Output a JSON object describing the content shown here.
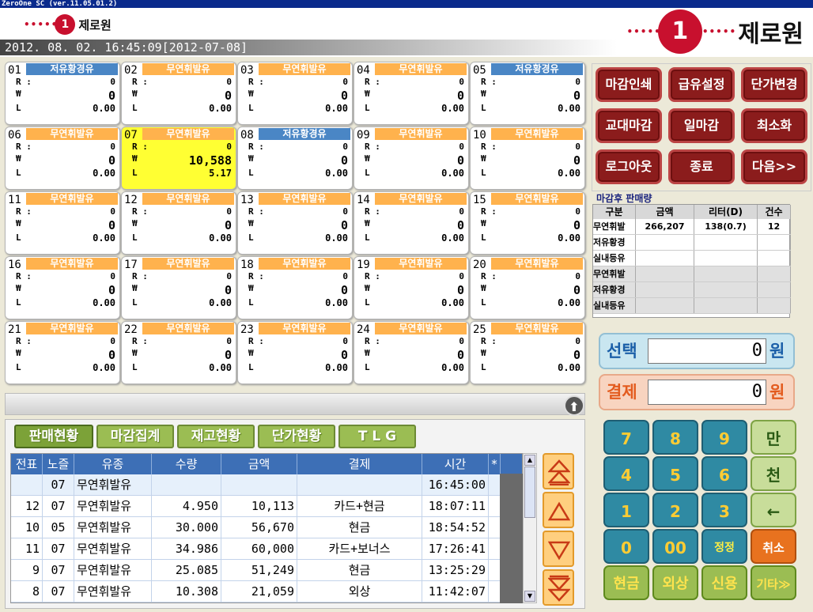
{
  "window": {
    "title": "ZeroOne SC (ver.11.05.01.2)"
  },
  "brand": {
    "small_logo": "제로원",
    "big_logo": "제로원",
    "logo_mark": "1",
    "dots": "•••••"
  },
  "datetime": "2012. 08. 02. 16:45:09[2012-07-08]",
  "field_labels": {
    "r": "R :",
    "won": "₩",
    "l": "L"
  },
  "nozzles": [
    {
      "no": "01",
      "fuel": "저유황경유",
      "color": "b",
      "r": "0",
      "w": "0",
      "l": "0.00"
    },
    {
      "no": "02",
      "fuel": "무연휘발유",
      "color": "o",
      "r": "0",
      "w": "0",
      "l": "0.00"
    },
    {
      "no": "03",
      "fuel": "무연휘발유",
      "color": "o",
      "r": "0",
      "w": "0",
      "l": "0.00"
    },
    {
      "no": "04",
      "fuel": "무연휘발유",
      "color": "o",
      "r": "0",
      "w": "0",
      "l": "0.00"
    },
    {
      "no": "05",
      "fuel": "저유황경유",
      "color": "b",
      "r": "0",
      "w": "0",
      "l": "0.00"
    },
    {
      "no": "06",
      "fuel": "무연휘발유",
      "color": "o",
      "r": "0",
      "w": "0",
      "l": "0.00"
    },
    {
      "no": "07",
      "fuel": "무연휘발유",
      "color": "o",
      "r": "0",
      "w": "10,588",
      "l": "5.17",
      "selected": true
    },
    {
      "no": "08",
      "fuel": "저유황경유",
      "color": "b",
      "r": "0",
      "w": "0",
      "l": "0.00"
    },
    {
      "no": "09",
      "fuel": "무연휘발유",
      "color": "o",
      "r": "0",
      "w": "0",
      "l": "0.00"
    },
    {
      "no": "10",
      "fuel": "무연휘발유",
      "color": "o",
      "r": "0",
      "w": "0",
      "l": "0.00"
    },
    {
      "no": "11",
      "fuel": "무연휘발유",
      "color": "o",
      "r": "0",
      "w": "0",
      "l": "0.00"
    },
    {
      "no": "12",
      "fuel": "무연휘발유",
      "color": "o",
      "r": "0",
      "w": "0",
      "l": "0.00"
    },
    {
      "no": "13",
      "fuel": "무연휘발유",
      "color": "o",
      "r": "0",
      "w": "0",
      "l": "0.00"
    },
    {
      "no": "14",
      "fuel": "무연휘발유",
      "color": "o",
      "r": "0",
      "w": "0",
      "l": "0.00"
    },
    {
      "no": "15",
      "fuel": "무연휘발유",
      "color": "o",
      "r": "0",
      "w": "0",
      "l": "0.00"
    },
    {
      "no": "16",
      "fuel": "무연휘발유",
      "color": "o",
      "r": "0",
      "w": "0",
      "l": "0.00"
    },
    {
      "no": "17",
      "fuel": "무연휘발유",
      "color": "o",
      "r": "0",
      "w": "0",
      "l": "0.00"
    },
    {
      "no": "18",
      "fuel": "무연휘발유",
      "color": "o",
      "r": "0",
      "w": "0",
      "l": "0.00"
    },
    {
      "no": "19",
      "fuel": "무연휘발유",
      "color": "o",
      "r": "0",
      "w": "0",
      "l": "0.00"
    },
    {
      "no": "20",
      "fuel": "무연휘발유",
      "color": "o",
      "r": "0",
      "w": "0",
      "l": "0.00"
    },
    {
      "no": "21",
      "fuel": "무연휘발유",
      "color": "o",
      "r": "0",
      "w": "0",
      "l": "0.00"
    },
    {
      "no": "22",
      "fuel": "무연휘발유",
      "color": "o",
      "r": "0",
      "w": "0",
      "l": "0.00"
    },
    {
      "no": "23",
      "fuel": "무연휘발유",
      "color": "o",
      "r": "0",
      "w": "0",
      "l": "0.00"
    },
    {
      "no": "24",
      "fuel": "무연휘발유",
      "color": "o",
      "r": "0",
      "w": "0",
      "l": "0.00"
    },
    {
      "no": "25",
      "fuel": "무연휘발유",
      "color": "o",
      "r": "0",
      "w": "0",
      "l": "0.00"
    }
  ],
  "tabs": [
    "판매현황",
    "마감집계",
    "재고현황",
    "단가현황",
    "T L G"
  ],
  "table": {
    "headers": [
      "전표",
      "노즐",
      "유종",
      "수량",
      "금액",
      "결제",
      "시간",
      "*"
    ],
    "rows": [
      [
        "",
        "07",
        "무연휘발유",
        "",
        "",
        "",
        "16:45:00"
      ],
      [
        "12",
        "07",
        "무연휘발유",
        "4.950",
        "10,113",
        "카드+현금",
        "18:07:11"
      ],
      [
        "10",
        "05",
        "무연휘발유",
        "30.000",
        "56,670",
        "현금",
        "18:54:52"
      ],
      [
        "11",
        "07",
        "무연휘발유",
        "34.986",
        "60,000",
        "카드+보너스",
        "17:26:41"
      ],
      [
        "9",
        "07",
        "무연휘발유",
        "25.085",
        "51,249",
        "현금",
        "13:25:29"
      ],
      [
        "8",
        "07",
        "무연휘발유",
        "10.308",
        "21,059",
        "외상",
        "11:42:07"
      ]
    ]
  },
  "functions": [
    "마감인쇄",
    "급유설정",
    "단가변경",
    "교대마감",
    "일마감",
    "최소화",
    "로그아웃",
    "종료",
    "다음>>"
  ],
  "summary": {
    "title": "마감후 판매량",
    "headers": [
      "구분",
      "금액",
      "리터(D)",
      "건수"
    ],
    "rows": [
      [
        "무연휘발",
        "266,207",
        "138(0.7)",
        "12"
      ],
      [
        "저유황경",
        "",
        "",
        ""
      ],
      [
        "실내등유",
        "",
        "",
        ""
      ],
      [
        "무연휘발",
        "",
        "",
        ""
      ],
      [
        "저유황경",
        "",
        "",
        ""
      ],
      [
        "실내등유",
        "",
        "",
        ""
      ]
    ]
  },
  "select": {
    "label": "선택",
    "value": "0",
    "unit": "원"
  },
  "payment": {
    "label": "결제",
    "value": "0",
    "unit": "원"
  },
  "keypad": {
    "k7": "7",
    "k8": "8",
    "k9": "9",
    "man": "만",
    "k4": "4",
    "k5": "5",
    "k6": "6",
    "cheon": "천",
    "k1": "1",
    "k2": "2",
    "k3": "3",
    "back": "←",
    "k0": "0",
    "k00": "00",
    "correct": "정정",
    "cancel": "취소",
    "cash": "현금",
    "credit_sale": "외상",
    "card": "신용",
    "other": "기타≫"
  },
  "colors": {
    "orange_header": "#ffb24d",
    "blue_header": "#4a86c5",
    "selected_cell": "#ffff33",
    "function_button": "#8b1c1c",
    "keypad_teal": "#2f8aa3"
  }
}
